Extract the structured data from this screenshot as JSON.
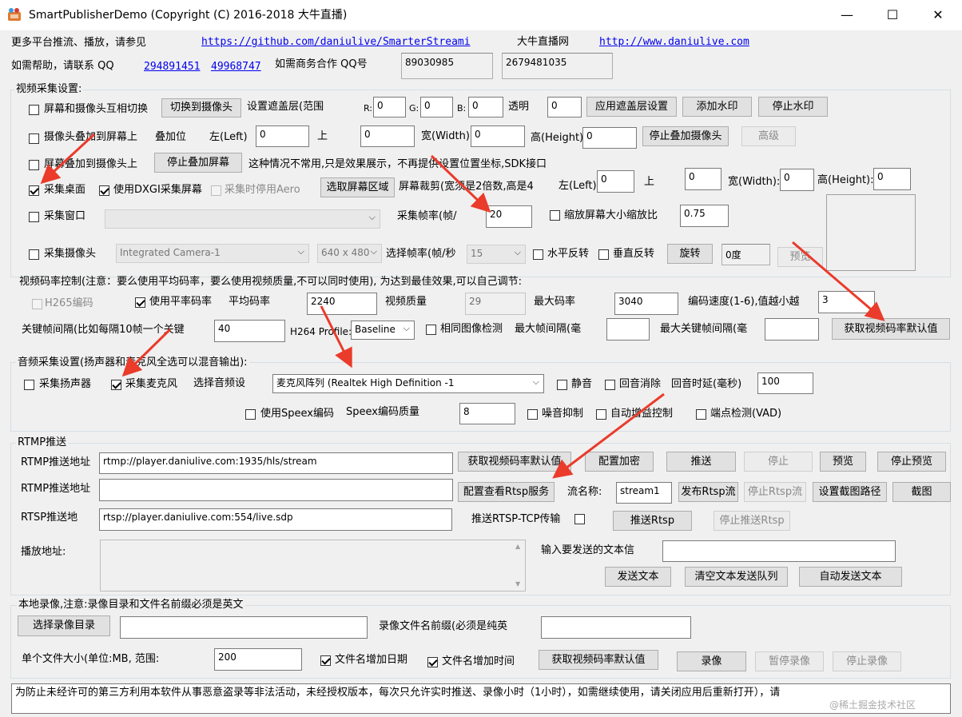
{
  "window": {
    "title": "SmartPublisherDemo  (Copyright (C) 2016-2018 大牛直播)",
    "minimize": "—",
    "maximize": "☐",
    "close": "✕"
  },
  "header": {
    "more_platforms": "更多平台推流、播放，请参见",
    "github_link": "https://github.com/daniulive/SmarterStreami",
    "daniu_label": "大牛直播网",
    "site_link": "http://www.daniulive.com",
    "help_label": "如需帮助，请联系 QQ",
    "qq1": "294891451",
    "qq2": "49968747",
    "biz_label": "如需商务合作 QQ号",
    "biz_qq1": "89030985",
    "biz_qq2": "2679481035"
  },
  "video_capture": {
    "group_title": "视频采集设置:",
    "row1": {
      "swap_label": "屏幕和摄像头互相切换",
      "switch_btn": "切换到摄像头",
      "mask_label": "设置遮盖层(范围",
      "r_label": "R:",
      "r_val": "0",
      "g_label": "G:",
      "g_val": "0",
      "b_label": "B:",
      "b_val": "0",
      "alpha_label": "透明",
      "alpha_val": "0",
      "apply_btn": "应用遮盖层设置",
      "add_wm_btn": "添加水印",
      "stop_wm_btn": "停止水印"
    },
    "row2": {
      "overlay_label": "摄像头叠加到屏幕上",
      "pos_label": "叠加位",
      "left_label": "左(Left)",
      "left_val": "0",
      "top_label": "上",
      "top_val": "0",
      "width_label": "宽(Width)",
      "width_val": "0",
      "height_label": "高(Height)",
      "height_val": "0",
      "stop_overlay_btn": "停止叠加摄像头",
      "advanced_btn": "高级"
    },
    "row3": {
      "screen_overlay_label": "屏幕叠加到摄像头上",
      "stop_screen_overlay_btn": "停止叠加屏幕",
      "note": "这种情况不常用,只是效果展示，不再提供设置位置坐标,SDK接口"
    },
    "row4": {
      "desktop_label": "采集桌面",
      "dxgi_label": "使用DXGI采集屏幕",
      "aero_label": "采集时停用Aero",
      "select_region_btn": "选取屏幕区域",
      "crop_label": "屏幕裁剪(宽须是2倍数,高是4",
      "left_label": "左(Left):",
      "left_val": "0",
      "top_label": "上",
      "top_val": "0",
      "width_label": "宽(Width):",
      "width_val": "0",
      "height_label": "高(Height):",
      "height_val": "0"
    },
    "row5": {
      "window_label": "采集窗口",
      "window_select": "",
      "fps_label": "采集帧率(帧/",
      "fps_val": "20",
      "scale_label": "缩放屏幕大小缩放比",
      "scale_val": "0.75"
    },
    "row6": {
      "camera_label": "采集摄像头",
      "camera_select": "Integrated Camera-1",
      "res_select": "640 x 480",
      "cam_fps_label": "选择帧率(帧/秒",
      "cam_fps_select": "15",
      "hflip_label": "水平反转",
      "vflip_label": "垂直反转",
      "rotate_btn": "旋转",
      "rotate_val": "0度",
      "preview_btn": "预览"
    }
  },
  "bitrate": {
    "title": "视频码率控制(注意：要么使用平均码率，要么使用视频质量,不可以同时使用), 为达到最佳效果,可以自己调节:",
    "h265_label": "H265编码",
    "avg_bitrate_chk": "使用平率码率",
    "avg_bitrate_label": "平均码率",
    "avg_bitrate_val": "2240",
    "quality_label": "视频质量",
    "quality_val": "29",
    "max_bitrate_label": "最大码率",
    "max_bitrate_val": "3040",
    "speed_label": "编码速度(1-6),值越小越",
    "speed_val": "3",
    "keyframe_label": "关键帧间隔(比如每隔10帧一个关键",
    "keyframe_val": "40",
    "profile_label": "H264 Profile:",
    "profile_val": "Baseline",
    "same_img_label": "相同图像检测",
    "max_frame_label": "最大帧间隔(毫",
    "max_frame_val": "",
    "max_key_label": "最大关键帧间隔(毫",
    "max_key_val": "",
    "default_btn": "获取视频码率默认值"
  },
  "audio": {
    "group_title": "音频采集设置(扬声器和麦克风全选可以混音输出):",
    "speaker_label": "采集扬声器",
    "mic_label": "采集麦克风",
    "device_label": "选择音频设",
    "device_val": "麦克风阵列 (Realtek High Definition -1",
    "mute_label": "静音",
    "echo_label": "回音消除",
    "echo_delay_label": "回音时延(毫秒)",
    "echo_delay_val": "100",
    "speex_label": "使用Speex编码",
    "speex_quality_label": "Speex编码质量",
    "speex_quality_val": "8",
    "noise_label": "噪音抑制",
    "agc_label": "自动增益控制",
    "vad_label": "端点检测(VAD)"
  },
  "rtmp": {
    "group_title": "RTMP推送",
    "url1_label": "RTMP推送地址",
    "url1_val": "rtmp://player.daniulive.com:1935/hls/stream",
    "get_default_btn": "获取视频码率默认值",
    "config_encrypt_btn": "配置加密",
    "push_btn": "推送",
    "stop_btn": "停止",
    "preview_btn": "预览",
    "stop_preview_btn": "停止预览",
    "url2_label": "RTMP推送地址",
    "url2_val": "",
    "rtsp_service_btn": "配置查看Rtsp服务",
    "stream_name_label": "流名称:",
    "stream_name_val": "stream1",
    "publish_rtsp_btn": "发布Rtsp流",
    "stop_rtsp_btn": "停止Rtsp流",
    "snapshot_path_btn": "设置截图路径",
    "snapshot_btn": "截图",
    "rtsp_label": "RTSP推送地",
    "rtsp_val": "rtsp://player.daniulive.com:554/live.sdp",
    "rtsp_tcp_label": "推送RTSP-TCP传输",
    "push_rtsp_btn": "推送Rtsp",
    "stop_push_rtsp_btn": "停止推送Rtsp",
    "play_url_label": "播放地址:",
    "play_url_val": "",
    "send_text_label": "输入要发送的文本信",
    "send_text_val": "",
    "send_text_btn": "发送文本",
    "clear_queue_btn": "清空文本发送队列",
    "auto_send_btn": "自动发送文本"
  },
  "record": {
    "group_title": "本地录像,注意:录像目录和文件名前缀必须是英文",
    "select_dir_btn": "选择录像目录",
    "dir_val": "",
    "prefix_label": "录像文件名前缀(必须是纯英",
    "prefix_val": "",
    "size_label": "单个文件大小(单位:MB, 范围:",
    "size_val": "200",
    "add_date_label": "文件名增加日期",
    "add_time_label": "文件名增加时间",
    "get_default_btn": "获取视频码率默认值",
    "record_btn": "录像",
    "pause_btn": "暂停录像",
    "stop_btn": "停止录像"
  },
  "footer": {
    "notice": "为防止未经许可的第三方利用本软件从事恶意盗录等非法活动，未经授权版本，每次只允许实时推送、录像小时（1小时），如需继续使用，请关闭应用后重新打开），请",
    "watermark": "@稀土掘金技术社区"
  }
}
